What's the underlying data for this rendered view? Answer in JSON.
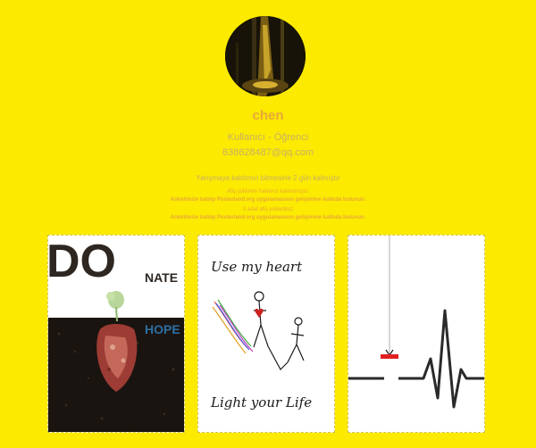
{
  "profile": {
    "username": "chen",
    "role": "Kullanıcı - Öğrenci",
    "email": "838628487@qq.com"
  },
  "notices": {
    "days_left": "Yarışmaya katılımın bitmesine 2 gün kalmıştır",
    "upload_limit": "Afiş yükleme hakkınız kalmamıştır.",
    "survey_1": "Anketimize katılıp Posterland.org uygulamasının gelişimine katkıda bulunun.",
    "uploaded_count": "3 adet afiş yüklediniz",
    "survey_2": "Anketimize katılıp Posterland.org uygulamasının gelişimine katkıda bulunun."
  },
  "posters": [
    {
      "words": [
        "DO",
        "NATE",
        "HOPE"
      ]
    },
    {
      "words": [
        "Use my heart",
        "Light your Life"
      ]
    },
    {
      "words": []
    }
  ],
  "colors": {
    "background": "#fcea00",
    "username": "#e8a838",
    "secondary_text": "#c9b066",
    "card_border": "#d4c24a",
    "hope_blue": "#2d6fa3",
    "pulse_red": "#e02020"
  }
}
